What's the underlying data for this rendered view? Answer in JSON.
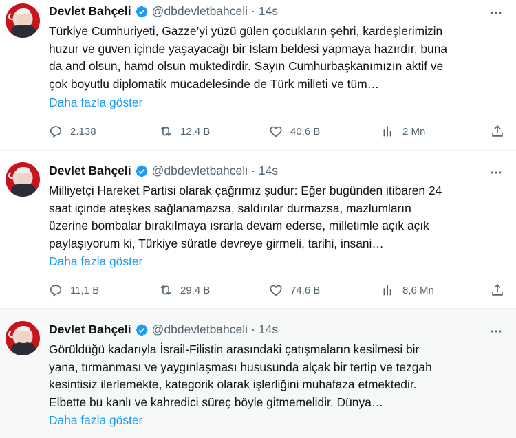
{
  "tweets": [
    {
      "author": "Devlet Bahçeli",
      "handle": "@dbdevletbahceli",
      "separator": "·",
      "time": "14s",
      "lines": [
        "Türkiye Cumhuriyeti, Gazze’yi yüzü gülen çocukların şehri, kardeşlerimizin",
        "huzur ve güven içinde yaşayacağı bir İslam beldesi yapmaya hazırdır, buna",
        "da and olsun, hamd olsun muktedirdir. Sayın Cumhurbaşkanımızın aktif ve",
        "çok boyutlu diplomatik mücadelesinde de Türk milleti ve tüm…"
      ],
      "show_more": "Daha fazla göster",
      "replies": "2.138",
      "reposts": "12,4 B",
      "likes": "40,6 B",
      "views": "2 Mn"
    },
    {
      "author": "Devlet Bahçeli",
      "handle": "@dbdevletbahceli",
      "separator": "·",
      "time": "14s",
      "lines": [
        "Milliyetçi Hareket Partisi olarak çağrımız şudur: Eğer bugünden itibaren 24",
        "saat içinde ateşkes sağlanamazsa, saldırılar durmazsa, mazlumların",
        "üzerine bombalar bırakılmaya ısrarla devam ederse, milletimle açık açık",
        "paylaşıyorum ki, Türkiye süratle devreye girmeli, tarihi, insani…"
      ],
      "show_more": "Daha fazla göster",
      "replies": "11,1 B",
      "reposts": "29,4 B",
      "likes": "74,6 B",
      "views": "8,6 Mn"
    },
    {
      "author": "Devlet Bahçeli",
      "handle": "@dbdevletbahceli",
      "separator": "·",
      "time": "14s",
      "lines": [
        "Görüldüğü kadarıyla İsrail-Filistin arasındaki çatışmaların kesilmesi bir",
        "yana, tırmanması ve yaygınlaşması hususunda alçak bir tertip ve tezgah",
        "kesintisiz ilerlemekte, kategorik olarak işlerliğini muhafaza etmektedir.",
        "Elbette bu kanlı ve kahredici süreç böyle gitmemelidir. Dünya…"
      ],
      "show_more": "Daha fazla göster"
    }
  ],
  "icons": {
    "verified": "verified-badge-icon",
    "more": "more-dots-icon",
    "reply": "reply-icon",
    "repost": "repost-icon",
    "like": "heart-icon",
    "views": "views-icon",
    "share": "share-icon"
  },
  "colors": {
    "accent": "#1d9bf0",
    "muted": "#536471",
    "text": "#0f1419",
    "highlight_bg": "#f7f9f9",
    "avatar_red": "#c8141c"
  }
}
